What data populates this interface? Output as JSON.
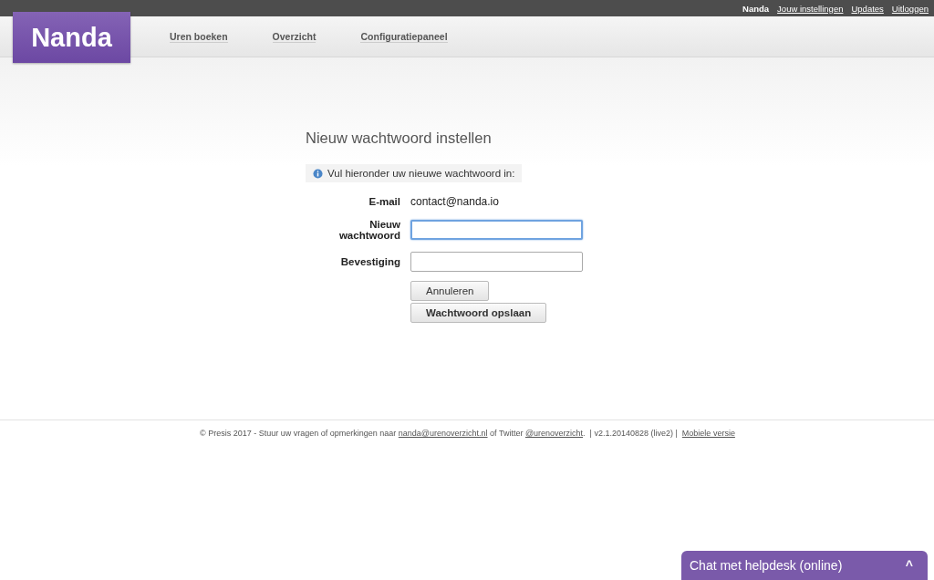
{
  "top_bar": {
    "user": "Nanda",
    "links": [
      {
        "label": "Jouw instellingen"
      },
      {
        "label": "Updates"
      },
      {
        "label": "Uitloggen"
      }
    ]
  },
  "header": {
    "logo": "Nanda",
    "nav": [
      {
        "label": "Uren boeken"
      },
      {
        "label": "Overzicht"
      },
      {
        "label": "Configuratiepaneel"
      }
    ]
  },
  "form": {
    "title": "Nieuw wachtwoord instellen",
    "info": "Vul hieronder uw nieuwe wachtwoord in:",
    "rows": [
      {
        "kind": "static",
        "label": "E-mail",
        "value": "contact@nanda.io"
      },
      {
        "kind": "password",
        "label": "Nieuw wachtwoord",
        "focused": true
      },
      {
        "kind": "password",
        "label": "Bevestiging",
        "focused": false
      }
    ],
    "buttons": [
      {
        "label": "Annuleren",
        "bold": false
      },
      {
        "label": "Wachtwoord opslaan",
        "bold": true
      }
    ]
  },
  "footer": {
    "text_before": "© Presis 2017 - Stuur uw vragen of opmerkingen naar",
    "email_link": "nanda@urenoverzicht.nl",
    "text_middle": "of Twitter",
    "twitter_link": "@urenoverzicht",
    "text_after": ".",
    "version": "|  v2.1.20140828 (live2)  |",
    "mobile_link": "Mobiele versie"
  },
  "chat": {
    "label": "Chat met helpdesk (online)",
    "caret": "^"
  }
}
